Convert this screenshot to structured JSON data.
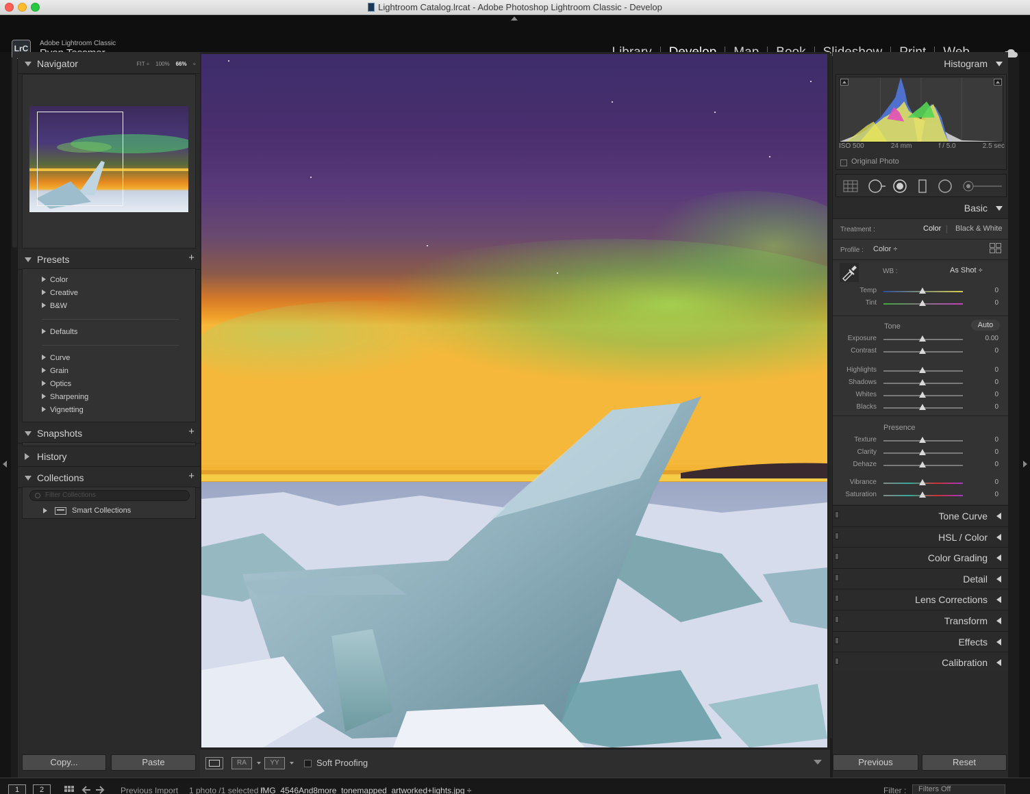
{
  "window": {
    "title": "Lightroom Catalog.lrcat - Adobe Photoshop Lightroom Classic - Develop"
  },
  "identity": {
    "logo": "LrC",
    "app_name": "Adobe Lightroom Classic",
    "user": "Ryan Tessmer"
  },
  "modules": [
    {
      "label": "Library",
      "active": false
    },
    {
      "label": "Develop",
      "active": true
    },
    {
      "label": "Map",
      "active": false
    },
    {
      "label": "Book",
      "active": false
    },
    {
      "label": "Slideshow",
      "active": false
    },
    {
      "label": "Print",
      "active": false
    },
    {
      "label": "Web",
      "active": false
    }
  ],
  "navigator": {
    "title": "Navigator",
    "zoom_fit": "FIT ÷",
    "zoom_100": "100%",
    "zoom_66": "66%"
  },
  "presets": {
    "title": "Presets",
    "add": "+",
    "groups": [
      [
        "Color",
        "Creative",
        "B&W"
      ],
      [
        "Defaults"
      ],
      [
        "Curve",
        "Grain",
        "Optics",
        "Sharpening",
        "Vignetting"
      ]
    ]
  },
  "snapshots": {
    "title": "Snapshots",
    "add": "+"
  },
  "history": {
    "title": "History"
  },
  "collections": {
    "title": "Collections",
    "add": "+",
    "filter_placeholder": "Filter Collections",
    "smart": "Smart Collections"
  },
  "left_buttons": {
    "copy": "Copy...",
    "paste": "Paste"
  },
  "toolbar": {
    "view1": "RA",
    "view2": "YY",
    "soft_proofing": "Soft Proofing"
  },
  "histogram": {
    "title": "Histogram",
    "iso": "ISO 500",
    "focal": "24 mm",
    "aperture": "f / 5.0",
    "shutter": "2.5 sec",
    "original_photo": "Original Photo"
  },
  "basic": {
    "title": "Basic",
    "treatment_label": "Treatment :",
    "treatment_color": "Color",
    "treatment_bw": "Black & White",
    "profile_label": "Profile :",
    "profile_value": "Color ÷",
    "wb_label": "WB :",
    "wb_value": "As Shot ÷",
    "tone_label": "Tone",
    "auto": "Auto",
    "presence_label": "Presence",
    "sliders": [
      {
        "label": "Temp",
        "value": "0",
        "gradient": "linear-gradient(90deg,#2f4f9c,#d6d04a)"
      },
      {
        "label": "Tint",
        "value": "0",
        "gradient": "linear-gradient(90deg,#3faa40,#c53fbf)"
      },
      {
        "label": "Exposure",
        "value": "0.00",
        "gradient": ""
      },
      {
        "label": "Contrast",
        "value": "0",
        "gradient": ""
      },
      {
        "label": "Highlights",
        "value": "0",
        "gradient": ""
      },
      {
        "label": "Shadows",
        "value": "0",
        "gradient": ""
      },
      {
        "label": "Whites",
        "value": "0",
        "gradient": ""
      },
      {
        "label": "Blacks",
        "value": "0",
        "gradient": ""
      },
      {
        "label": "Texture",
        "value": "0",
        "gradient": ""
      },
      {
        "label": "Clarity",
        "value": "0",
        "gradient": ""
      },
      {
        "label": "Dehaze",
        "value": "0",
        "gradient": ""
      },
      {
        "label": "Vibrance",
        "value": "0",
        "gradient": "linear-gradient(90deg,#888,#3a9,#c33,#a3c)"
      },
      {
        "label": "Saturation",
        "value": "0",
        "gradient": "linear-gradient(90deg,#888,#3a9,#c33,#a3c)"
      }
    ]
  },
  "collapsed_panels": [
    "Tone Curve",
    "HSL / Color",
    "Color Grading",
    "Detail",
    "Lens Corrections",
    "Transform",
    "Effects",
    "Calibration"
  ],
  "right_buttons": {
    "previous": "Previous",
    "reset": "Reset"
  },
  "filmstrip": {
    "monitor1": "1",
    "monitor2": "2",
    "source": "Previous Import",
    "selection": "1 photo /1 selected /",
    "filename": "IMG_4546And8more_tonemapped_artworked+lights.jpg ÷",
    "filter_label": "Filter :",
    "filter_value": "Filters Off"
  }
}
